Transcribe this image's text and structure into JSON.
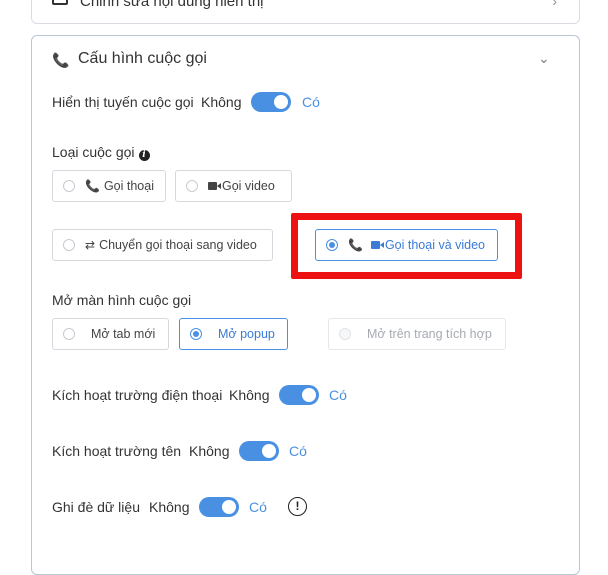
{
  "prev_section": {
    "title": "Chỉnh sửa nội dung hiển thị"
  },
  "section": {
    "title": "Cấu hình cuộc gọi",
    "icon": "phone-icon"
  },
  "show_call_route": {
    "label": "Hiển thị tuyến cuộc gọi",
    "off": "Không",
    "on": "Có",
    "value": true
  },
  "call_type": {
    "label": "Loại cuộc gọi",
    "options": [
      {
        "label": "Gọi thoại",
        "icon": "phone-icon",
        "selected": false
      },
      {
        "label": "Gọi video",
        "icon": "video-camera-icon",
        "selected": false
      },
      {
        "label": "Chuyển gọi thoại sang video",
        "icon": "swap-icon",
        "selected": false
      },
      {
        "label": "Gọi thoại và video",
        "icon": "phone-video-icon",
        "selected": true
      }
    ]
  },
  "open_call_screen": {
    "label": "Mở màn hình cuộc gọi",
    "options": [
      {
        "label": "Mở tab mới",
        "selected": false,
        "disabled": false
      },
      {
        "label": "Mở popup",
        "selected": true,
        "disabled": false
      },
      {
        "label": "Mở trên trang tích hợp",
        "selected": false,
        "disabled": true
      }
    ]
  },
  "enable_phone_field": {
    "label": "Kích hoạt trường điện thoại",
    "off": "Không",
    "on": "Có",
    "value": true
  },
  "enable_name_field": {
    "label": "Kích hoạt trường tên",
    "off": "Không",
    "on": "Có",
    "value": true
  },
  "overwrite_data": {
    "label": "Ghi đè dữ liệu",
    "off": "Không",
    "on": "Có",
    "value": true,
    "info_icon": "exclamation-icon"
  },
  "colors": {
    "accent": "#4a90e2",
    "highlight": "#ee1111",
    "border": "#b9c6d3"
  }
}
